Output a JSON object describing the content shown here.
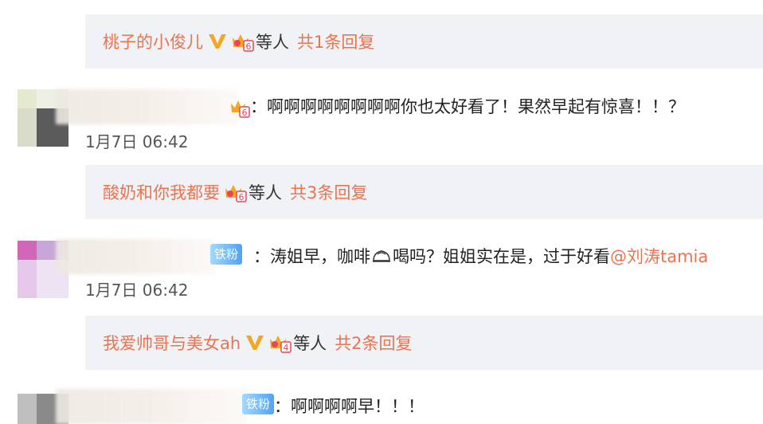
{
  "threads": [
    {
      "names": "桃子的小俊儿",
      "suffix": "等人",
      "count": "共1条回复",
      "has_v": true,
      "crown_level": "6"
    },
    {
      "names": "酸奶和你我都要",
      "suffix": "等人",
      "count": "共3条回复",
      "has_v": false,
      "crown_level": "6"
    },
    {
      "names": "我爱帅哥与美女ah",
      "suffix": "等人",
      "count": "共2条回复",
      "has_v": true,
      "crown_level": "4"
    }
  ],
  "comments": [
    {
      "text": "：啊啊啊啊啊啊啊啊你也太好看了！果然早起有惊喜！！？",
      "time": "1月7日  06:42",
      "badge": "6"
    },
    {
      "text_pre": "：涛姐早，咖啡",
      "text_post": "喝吗？姐姐实在是，过于好看",
      "mention": "@刘涛tamia",
      "time": "1月7日  06:42",
      "badge": "铁粉"
    },
    {
      "text": "：啊啊啊啊早！！！",
      "badge": "铁粉"
    }
  ],
  "colors": {
    "link": "#eb7350",
    "bar_bg": "#f1f2f5",
    "fan_badge": "#4fa3f7"
  },
  "icons": [
    "verified-v-icon",
    "crown-fan-icon",
    "coffee-cup-emoji-icon"
  ]
}
